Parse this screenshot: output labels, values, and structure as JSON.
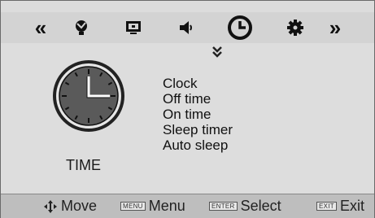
{
  "nav": {
    "prev_glyph": "«",
    "next_glyph": "»",
    "tabs": [
      {
        "name": "channel",
        "icon": "satellite-dish-icon"
      },
      {
        "name": "picture",
        "icon": "monitor-icon"
      },
      {
        "name": "sound",
        "icon": "speaker-icon"
      },
      {
        "name": "time",
        "icon": "clock-icon",
        "selected": true
      },
      {
        "name": "setup",
        "icon": "gear-icon"
      }
    ]
  },
  "section": {
    "label": "TIME",
    "scroll_indicator": "chevron-double-down-icon"
  },
  "menu": {
    "items": [
      "Clock",
      "Off time",
      "On time",
      "Sleep timer",
      "Auto sleep"
    ]
  },
  "footer": {
    "move": {
      "label": "Move"
    },
    "menu": {
      "key": "MENU",
      "label": "Menu"
    },
    "select": {
      "key": "ENTER",
      "label": "Select"
    },
    "exit": {
      "key": "EXIT",
      "label": "Exit"
    }
  },
  "colors": {
    "panel": "#dddddd",
    "tabbar": "#d3d3d3",
    "footer": "#bebebe",
    "clock_face": "#5a5a5a"
  }
}
